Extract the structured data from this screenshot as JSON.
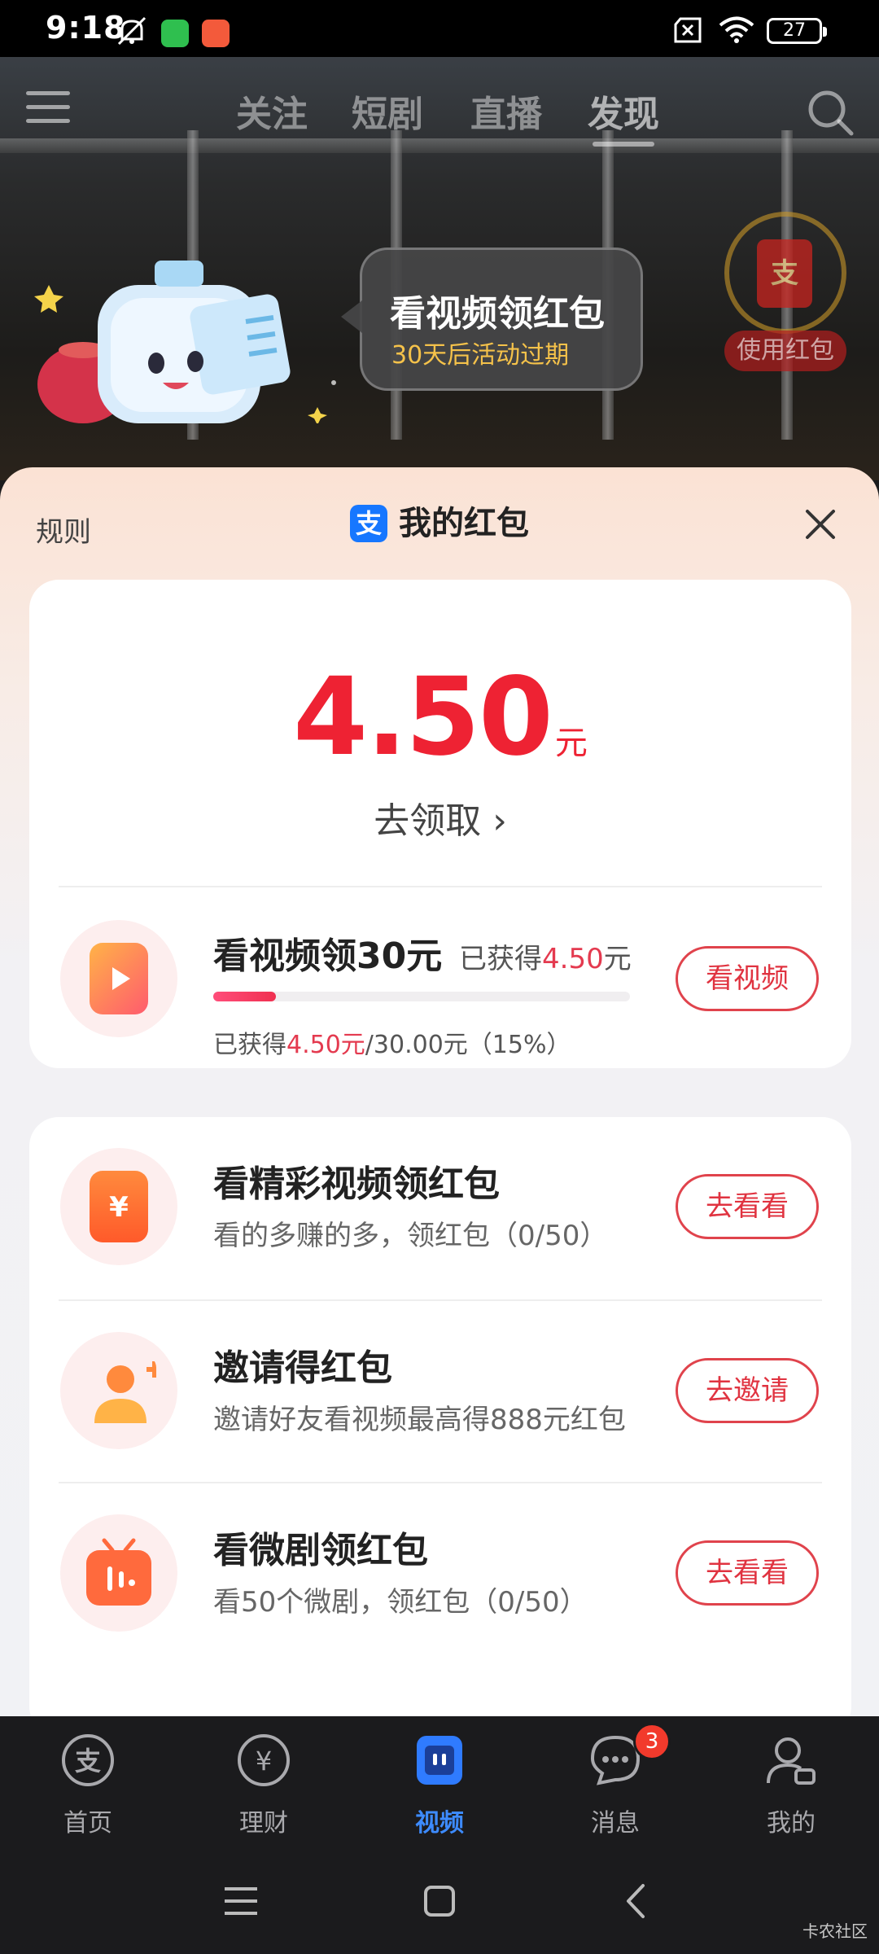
{
  "status_bar": {
    "time": "9:18",
    "battery": "27",
    "icons": [
      "mute-icon",
      "download-app-icon",
      "app-notification-icon",
      "no-sim-icon",
      "wifi-icon",
      "battery-icon"
    ]
  },
  "top_nav": {
    "tabs": [
      "关注",
      "短剧",
      "直播",
      "发现"
    ],
    "active_tab": "发现"
  },
  "promo": {
    "title": "看视频领红包",
    "subtitle": "30天后活动过期",
    "use_redpack_label": "使用红包",
    "redpack_glyph": "支"
  },
  "sheet": {
    "rules_label": "规则",
    "title": "我的红包",
    "logo_glyph": "支"
  },
  "balance": {
    "amount": "4.50",
    "unit": "元",
    "claim_label": "去领取 ›"
  },
  "watch_task": {
    "title": "看视频领30元",
    "earned_prefix": "已获得",
    "earned_value": "4.50",
    "earned_unit": "元",
    "progress_prefix": "已获得",
    "progress_value": "4.50元",
    "progress_suffix": "/30.00元（15%）",
    "progress_fraction": 0.15,
    "button_label": "看视频"
  },
  "tasks": [
    {
      "title": "看精彩视频领红包",
      "subtitle": "看的多赚的多，领红包（0/50）",
      "button_label": "去看看",
      "icon": "red-envelope-icon"
    },
    {
      "title": "邀请得红包",
      "subtitle": "邀请好友看视频最高得888元红包",
      "button_label": "去邀请",
      "icon": "invite-user-icon"
    },
    {
      "title": "看微剧领红包",
      "subtitle": "看50个微剧，领红包（0/50）",
      "button_label": "去看看",
      "icon": "mini-drama-icon"
    }
  ],
  "tab_bar": {
    "tabs": [
      {
        "label": "首页",
        "icon": "alipay-home-icon"
      },
      {
        "label": "理财",
        "icon": "finance-icon"
      },
      {
        "label": "视频",
        "icon": "video-icon"
      },
      {
        "label": "消息",
        "icon": "message-icon"
      },
      {
        "label": "我的",
        "icon": "profile-icon"
      }
    ],
    "active": "视频",
    "message_badge": "3"
  },
  "watermark": "卡农社区",
  "colors": {
    "accent_red": "#ee2233",
    "button_border": "#e0434c",
    "active_tab_blue": "#3d8bff",
    "alipay_blue": "#1677ff"
  }
}
